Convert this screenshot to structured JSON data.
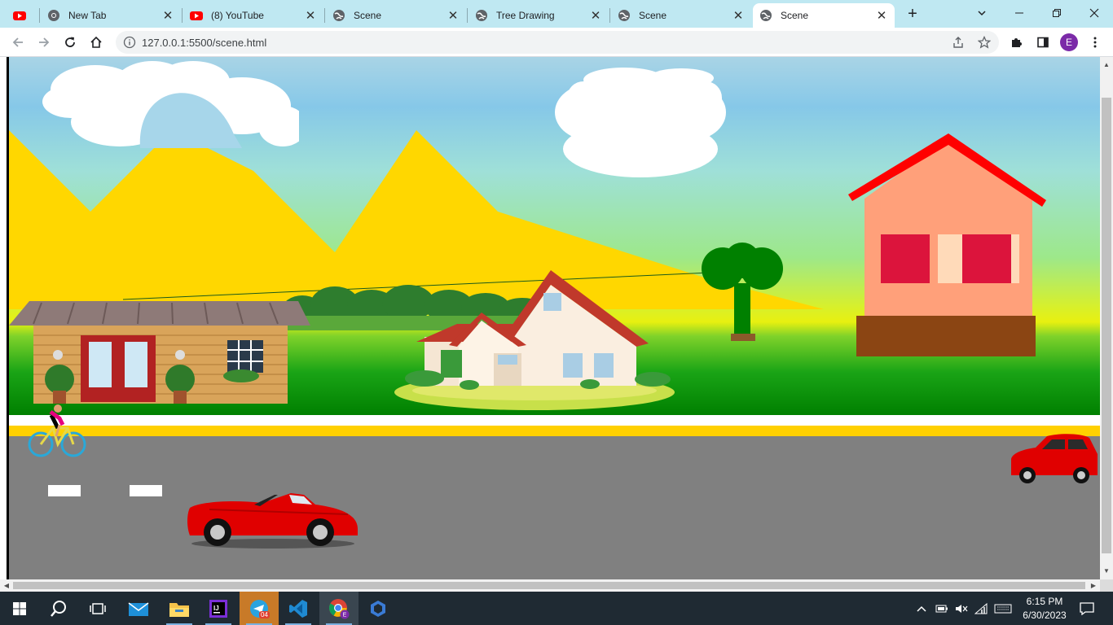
{
  "browser": {
    "tabs": [
      {
        "title": "New Tab",
        "favicon": "chrome-icon",
        "active": false
      },
      {
        "title": "(8) YouTube",
        "favicon": "youtube-icon",
        "active": false
      },
      {
        "title": "Scene",
        "favicon": "globe-icon",
        "active": false
      },
      {
        "title": "Tree Drawing",
        "favicon": "globe-icon",
        "active": false
      },
      {
        "title": "Scene",
        "favicon": "globe-icon",
        "active": false
      },
      {
        "title": "Scene",
        "favicon": "globe-icon",
        "active": true
      }
    ],
    "pinned_favicon": "youtube-icon",
    "new_tab_label": "+",
    "url": "127.0.0.1:5500/scene.html",
    "profile_initial": "E"
  },
  "scene": {
    "colors": {
      "mountain": "#ffd700",
      "cloud": "#ffffff",
      "road": "#808080",
      "stripe_yellow": "#ffd000",
      "grass": "#008000",
      "house_wall": "#ffa07a",
      "house_roof": "#ff0000",
      "house_window": "#dc143c",
      "house_base": "#8b4513",
      "tree_crown": "#008000",
      "car": "#e00000"
    },
    "objects": [
      "cloud",
      "cloud",
      "mountains",
      "forest",
      "wooden-house",
      "cottage",
      "tree",
      "pink-house",
      "cyclist",
      "sports-car",
      "red-hatchback"
    ]
  },
  "taskbar": {
    "apps": [
      "start-icon",
      "search-icon",
      "task-view-icon",
      "mail-icon",
      "file-explorer-icon",
      "intellij-icon",
      "telegram-icon",
      "vscode-icon",
      "chrome-icon",
      "copilot-icon"
    ],
    "telegram_badge": "04",
    "time": "6:15 PM",
    "date": "6/30/2023"
  }
}
